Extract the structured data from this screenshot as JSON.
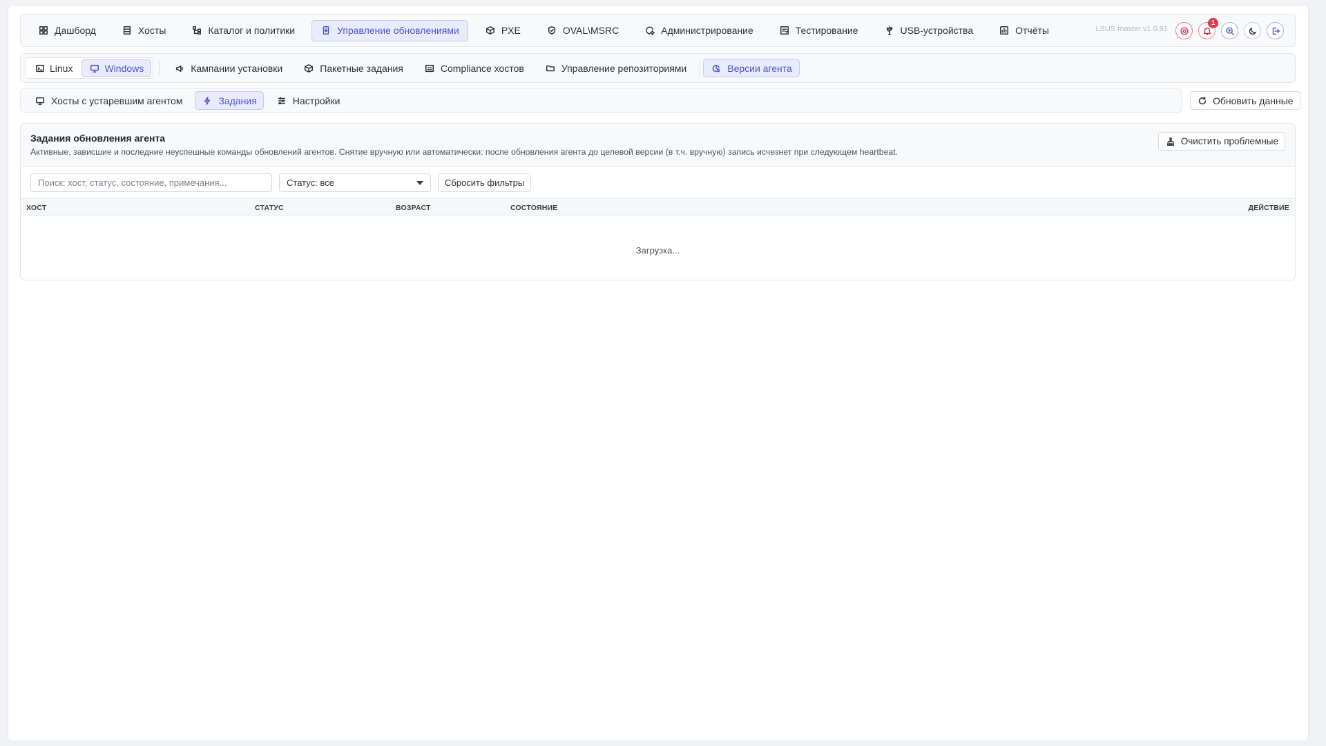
{
  "app": {
    "version": "LSUS master v1.0.91"
  },
  "topnav": [
    {
      "label": "Дашборд",
      "icon": "dashboard-icon",
      "active": false
    },
    {
      "label": "Хосты",
      "icon": "server-icon",
      "active": false
    },
    {
      "label": "Каталог и политики",
      "icon": "tree-icon",
      "active": false
    },
    {
      "label": "Управление обновлениями",
      "icon": "update-file-icon",
      "active": true
    },
    {
      "label": "PXE",
      "icon": "box-icon",
      "active": false
    },
    {
      "label": "OVAL\\MSRC",
      "icon": "shield-icon",
      "active": false
    },
    {
      "label": "Администрирование",
      "icon": "admin-gear-icon",
      "active": false
    },
    {
      "label": "Тестирование",
      "icon": "test-icon",
      "active": false
    },
    {
      "label": "USB-устройства",
      "icon": "usb-icon",
      "active": false
    },
    {
      "label": "Отчёты",
      "icon": "report-icon",
      "active": false
    }
  ],
  "notifications": {
    "count": "1"
  },
  "os_tabs": [
    {
      "label": "Linux",
      "icon": "terminal-icon",
      "active": false
    },
    {
      "label": "Windows",
      "icon": "monitor-icon",
      "active": true
    }
  ],
  "subnav": [
    {
      "label": "Кампании установки",
      "icon": "megaphone-icon",
      "active": false
    },
    {
      "label": "Пакетные задания",
      "icon": "package-icon",
      "active": false
    },
    {
      "label": "Compliance хостов",
      "icon": "compliance-icon",
      "active": false
    },
    {
      "label": "Управление репозиториями",
      "icon": "folder-icon",
      "active": false
    },
    {
      "label": "Версии агента",
      "icon": "agent-version-icon",
      "active": true
    }
  ],
  "tabs": [
    {
      "label": "Хосты с устаревшим агентом",
      "icon": "monitor-icon",
      "active": false
    },
    {
      "label": "Задания",
      "icon": "bolt-icon",
      "active": true
    },
    {
      "label": "Настройки",
      "icon": "sliders-icon",
      "active": false
    }
  ],
  "refresh_label": "Обновить данные",
  "card": {
    "title": "Задания обновления агента",
    "description": "Активные, зависшие и последние неуспешные команды обновлений агентов. Снятие вручную или автоматически: после обновления агента до целевой версии (в т.ч. вручную) запись исчезнет при следующем heartbeat.",
    "clear_label": "Очистить проблемные",
    "search_placeholder": "Поиск: хост, статус, состояние, примечания...",
    "status_filter": "Статус: все",
    "reset_label": "Сбросить фильтры",
    "columns": {
      "host": "ХОСТ",
      "status": "СТАТУС",
      "age": "ВОЗРАСТ",
      "state": "СОСТОЯНИЕ",
      "action": "ДЕЙСТВИЕ"
    },
    "loading": "Загрузка..."
  },
  "colors": {
    "accent": "#4a56c9",
    "accent_bg": "#e8ebfb",
    "danger": "#e03a47"
  }
}
